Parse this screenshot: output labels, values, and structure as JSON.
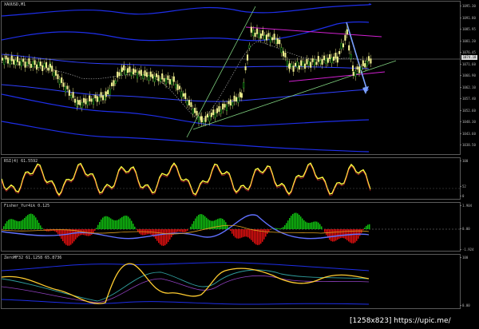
{
  "window": {
    "symbol_label": "XAUUSD,M1"
  },
  "main_panel": {
    "price_ticks": [
      "1095.30",
      "1091.80",
      "1085.95",
      "1081.20",
      "1076.45",
      "1071.60",
      "1066.90",
      "1062.10",
      "1057.40",
      "1052.60",
      "1048.30",
      "1043.60",
      "1038.50"
    ],
    "current_price": "1074.18"
  },
  "rsi_panel": {
    "label": "RSI(4) 61.5592",
    "ticks": [
      "100",
      "52",
      "0"
    ]
  },
  "fisher_panel": {
    "label": "Fisher_Yur4ik 0.125",
    "ticks": [
      "1.904",
      "0.00",
      "-1.924"
    ]
  },
  "osc_panel": {
    "label": "ZeroMF32 61.1258 65.8736",
    "ticks": [
      "100",
      "0.00"
    ]
  },
  "watermark": "[1258x823] https://upic.me/",
  "colors": {
    "background": "#000000",
    "candles": "#f0f090",
    "bands": "#1e2ee8",
    "trendline_green": "#7fd07f",
    "trendline_magenta": "#d020d0",
    "arrow": "#7aa0ff",
    "rsi_line": "#ffff40",
    "fisher_up": "#10c010",
    "fisher_down": "#e01010"
  }
}
